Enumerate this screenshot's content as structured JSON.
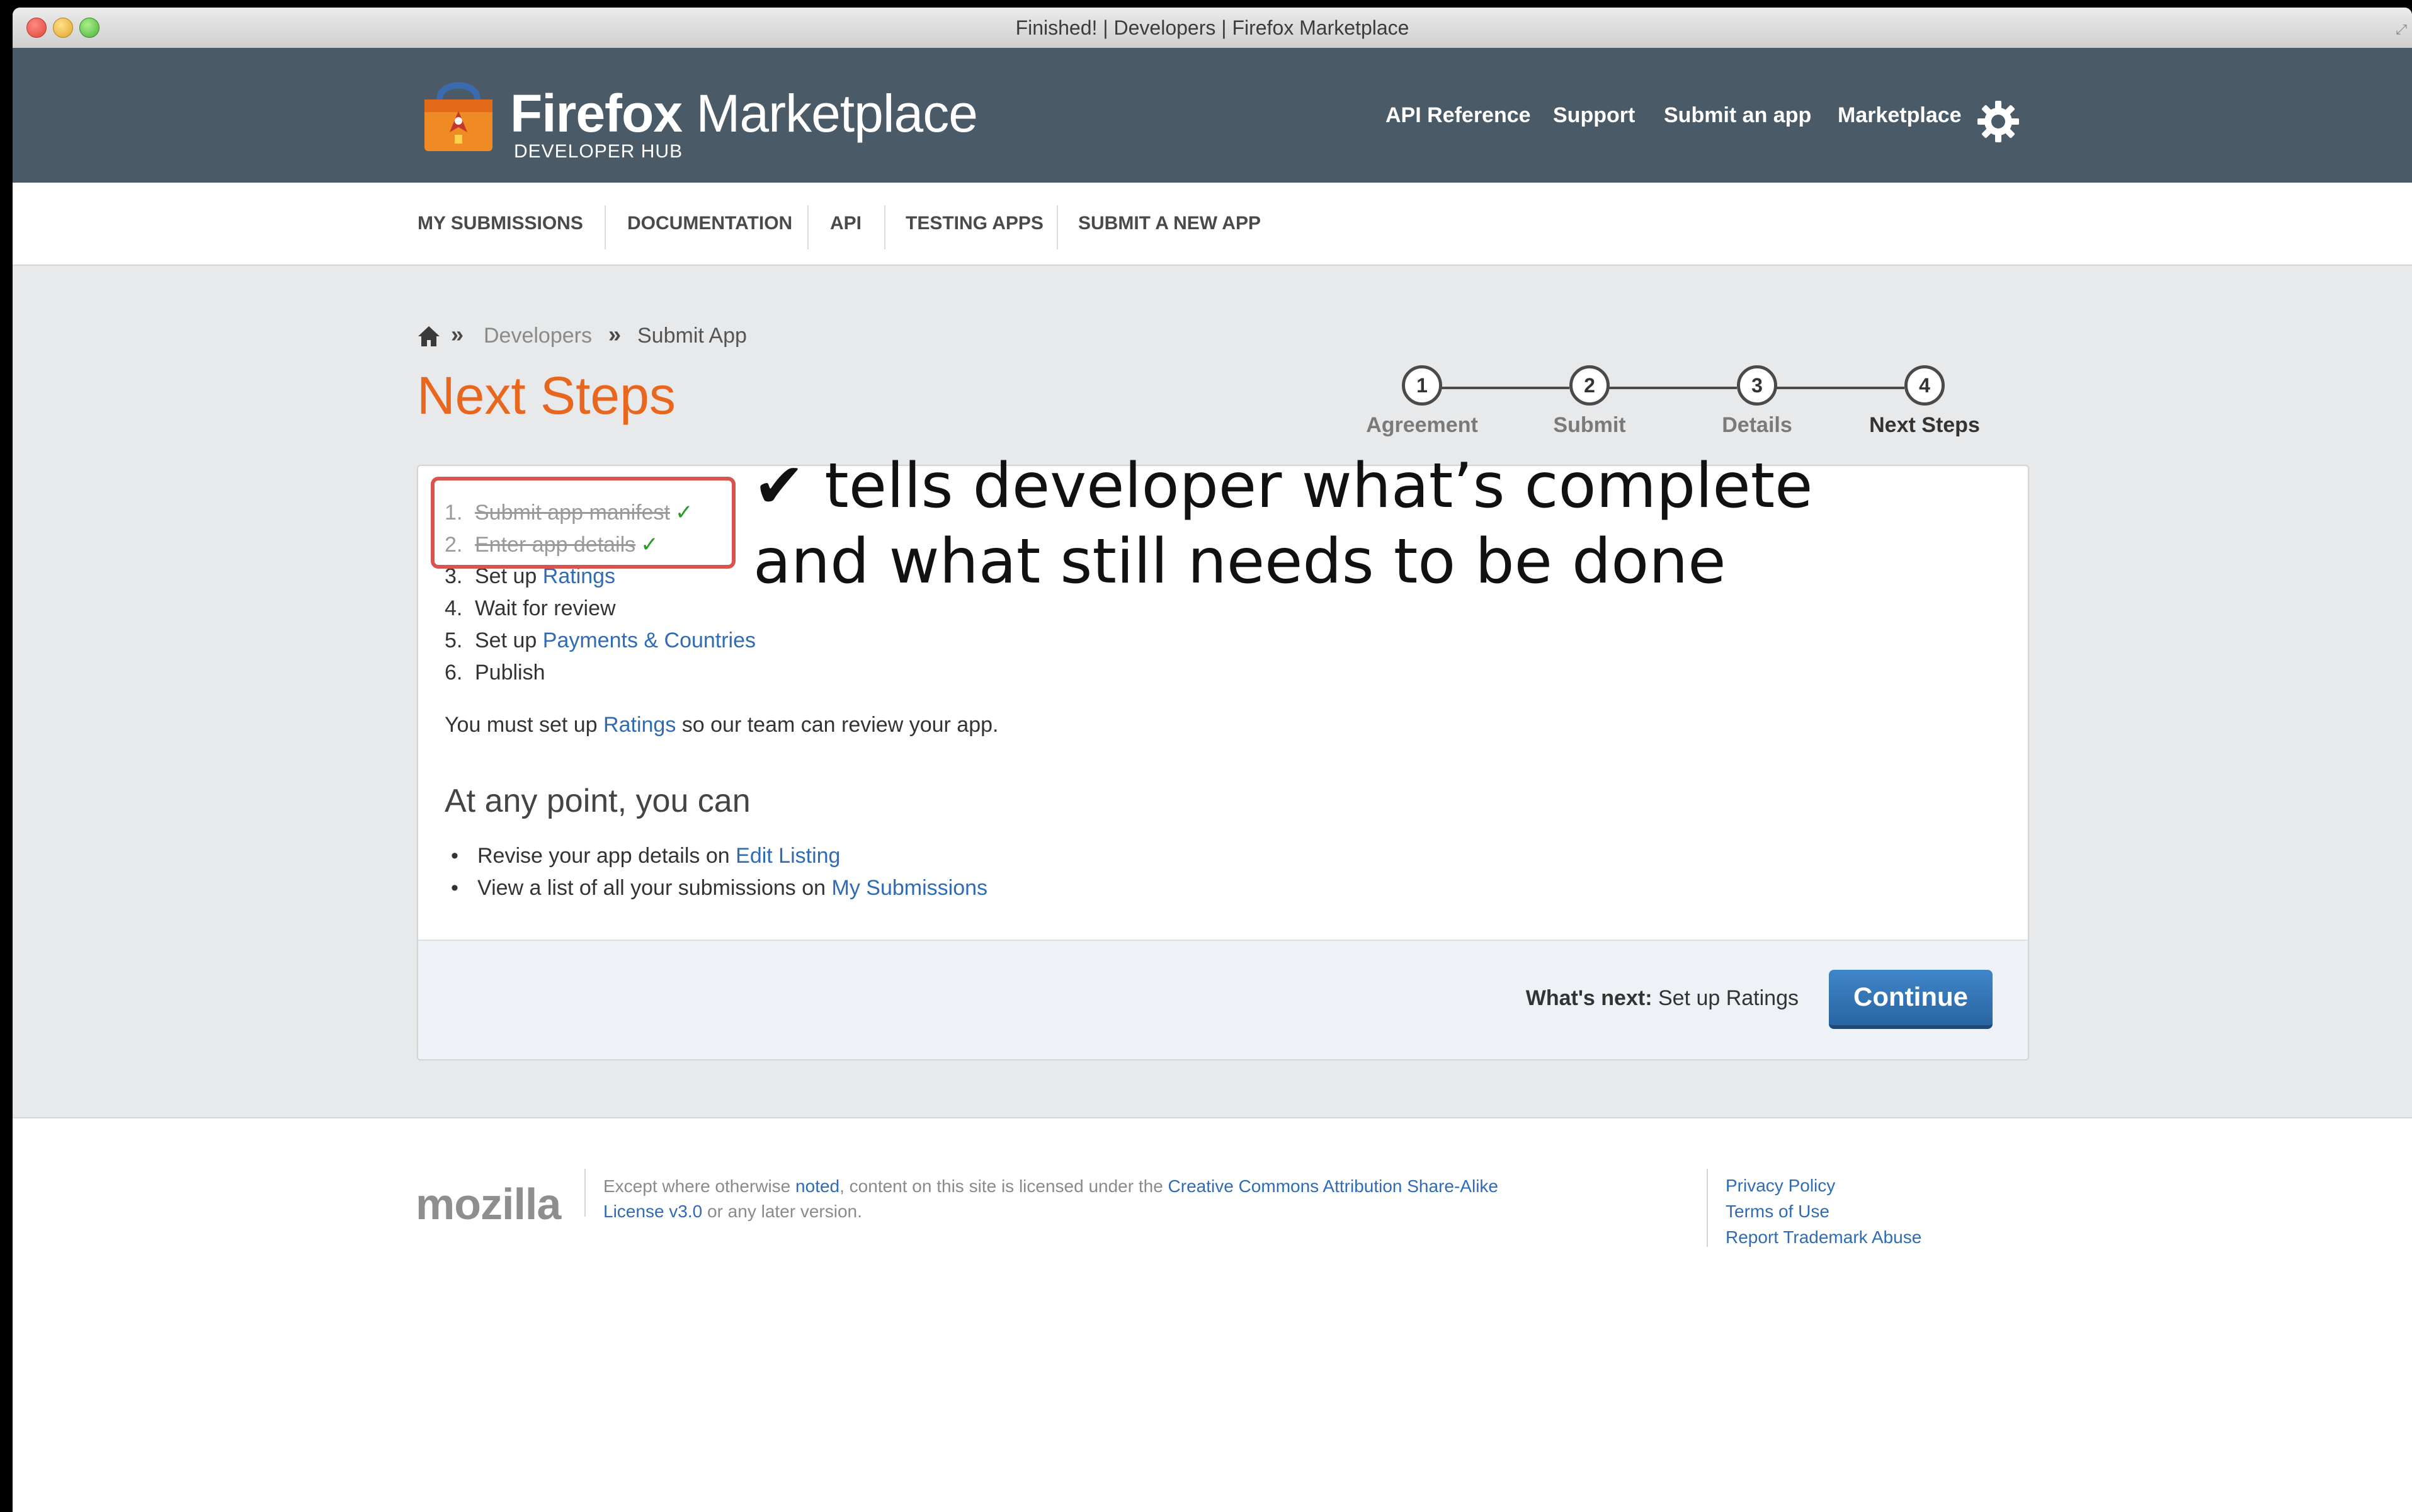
{
  "window": {
    "title": "Finished! | Developers | Firefox Marketplace"
  },
  "header": {
    "brand_bold": "Firefox",
    "brand_rest": "Marketplace",
    "brand_sub": "DEVELOPER HUB",
    "nav": [
      "API Reference",
      "Support",
      "Submit an app",
      "Marketplace"
    ]
  },
  "subnav": [
    "MY SUBMISSIONS",
    "DOCUMENTATION",
    "API",
    "TESTING APPS",
    "SUBMIT A NEW APP"
  ],
  "breadcrumb": [
    "Developers",
    "Submit App"
  ],
  "page_title": "Next Steps",
  "steps": [
    {
      "num": "1",
      "label": "Agreement"
    },
    {
      "num": "2",
      "label": "Submit"
    },
    {
      "num": "3",
      "label": "Details"
    },
    {
      "num": "4",
      "label": "Next Steps"
    }
  ],
  "checklist": [
    {
      "num": "1.",
      "text": "Submit app manifest",
      "check": "✓"
    },
    {
      "num": "2.",
      "text": "Enter app details",
      "check": "✓"
    },
    {
      "num": "3.",
      "text": "Set up",
      "link": "Ratings"
    },
    {
      "num": "4.",
      "text": "Wait for review"
    },
    {
      "num": "5.",
      "text": "Set up",
      "link": "Payments & Countries"
    },
    {
      "num": "6.",
      "text": "Publish"
    }
  ],
  "notice": {
    "before": "You must set up",
    "link": "Ratings",
    "after": "so our team can review your app."
  },
  "any_point": {
    "heading": "At any point, you can",
    "items": [
      {
        "text": "Revise your app details on",
        "link": "Edit Listing"
      },
      {
        "text": "View a list of all your submissions on",
        "link": "My Submissions"
      }
    ]
  },
  "footer_bar": {
    "whats_next_label": "What's next:",
    "whats_next_value": "Set up Ratings",
    "continue_label": "Continue"
  },
  "annotation": {
    "line1": "✔ tells developer what’s complete",
    "line2": "and what still needs to be done"
  },
  "footer": {
    "logo": "mozilla",
    "license_a": "Except where otherwise",
    "license_link1": "noted",
    "license_b": ", content on this site is licensed under the",
    "license_link2": "Creative Commons Attribution Share-Alike License v3.0",
    "license_c": "or any later version.",
    "links": [
      "Privacy Policy",
      "Terms of Use",
      "Report Trademark Abuse"
    ]
  },
  "colors": {
    "header_bg": "#4a5a66",
    "title_orange": "#e8661e",
    "link_blue": "#2f6cb5",
    "button_blue": "#2a65a3",
    "annotation_red": "#d9534f"
  }
}
